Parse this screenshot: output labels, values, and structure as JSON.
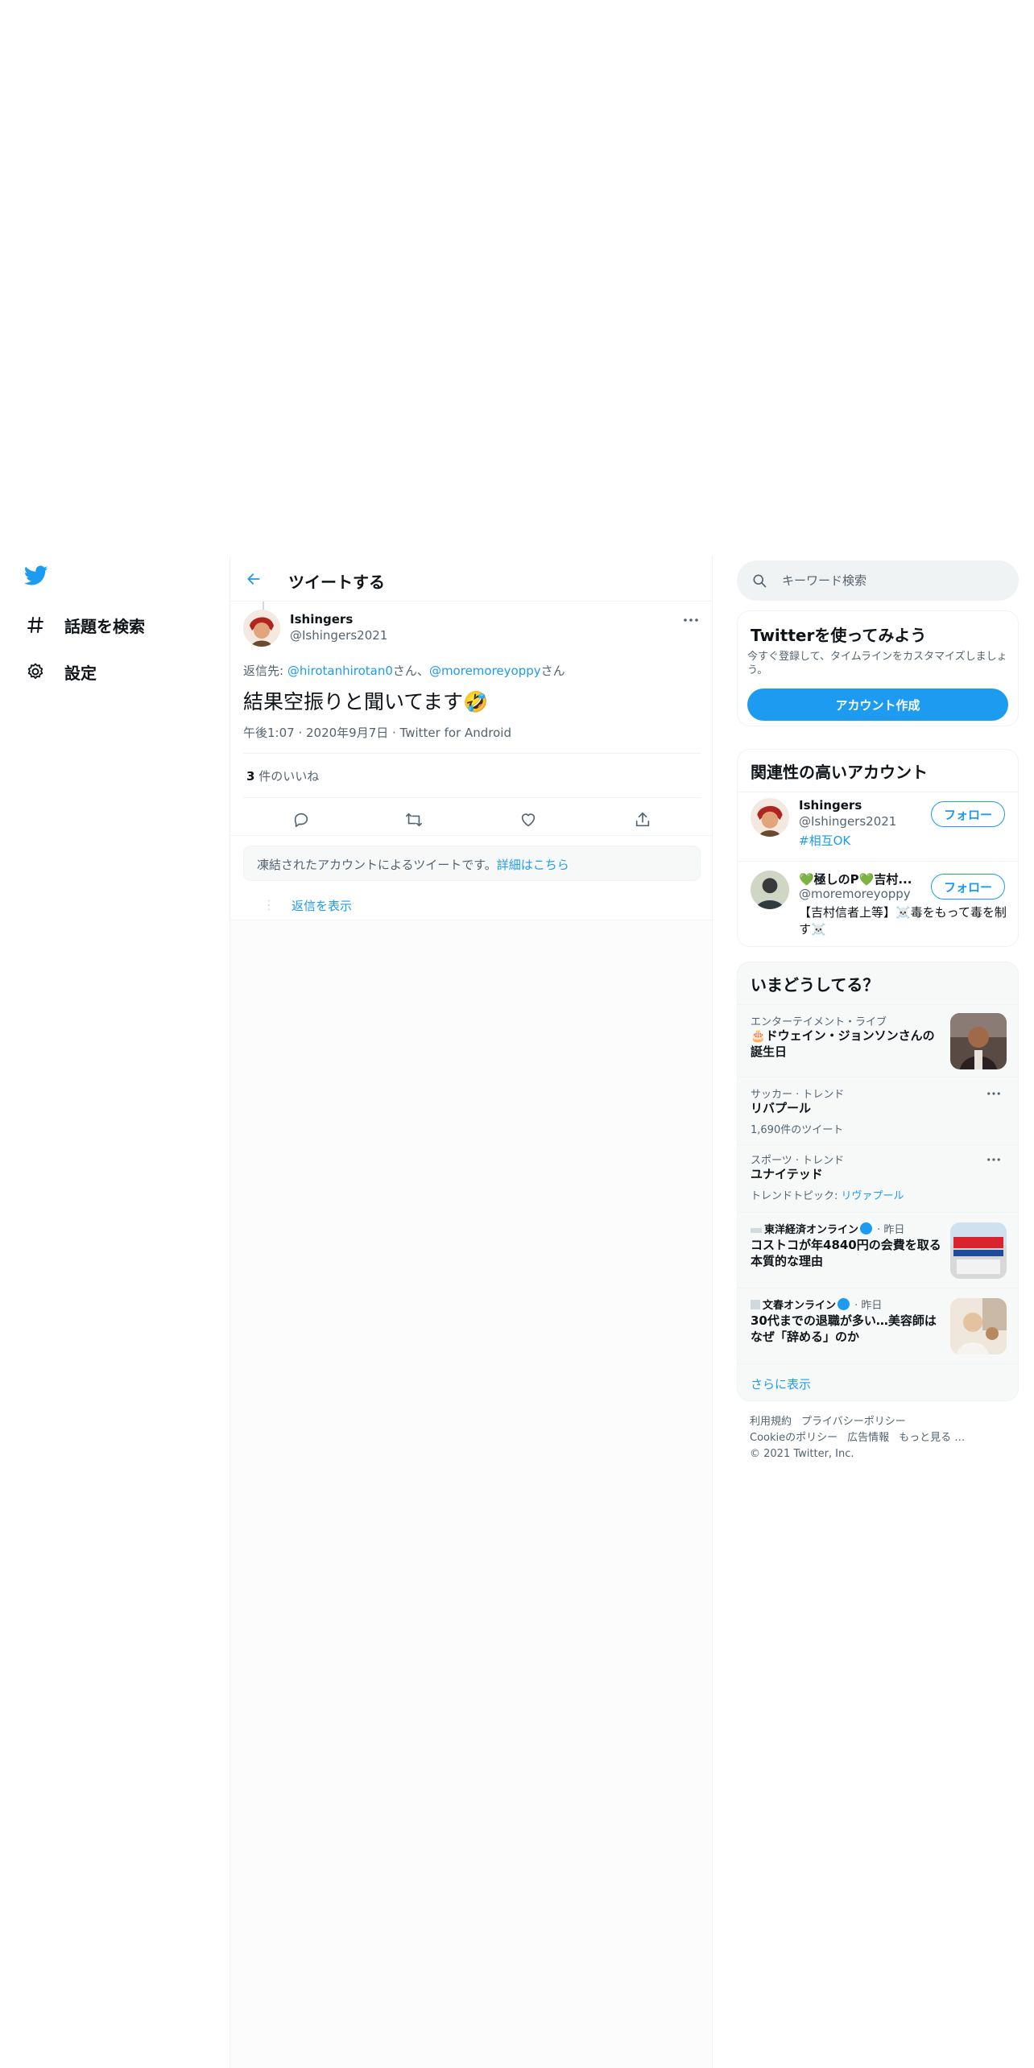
{
  "nav": {
    "logo": "twitter-bird-icon",
    "items": [
      {
        "label": "話題を検索",
        "icon": "hashtag-icon"
      },
      {
        "label": "設定",
        "icon": "gear-icon"
      }
    ]
  },
  "header": {
    "title": "ツイートする"
  },
  "tweet": {
    "name": "Ishingers",
    "handle": "@Ishingers2021",
    "reply_prefix": "返信先: ",
    "reply_user1": "@hirotanhirotan0",
    "reply_san1": "さん、",
    "reply_user2": "@moremoreyoppy",
    "reply_san2": "さん",
    "text": "結果空振りと聞いてます🤣",
    "meta": "午後1:07 · 2020年9月7日 · Twitter for Android",
    "likes_count": "3",
    "likes_label": " 件のいいね"
  },
  "notice": {
    "text": "凍結されたアカウントによるツイートです。",
    "link": "詳細はこちら"
  },
  "show_replies": "返信を表示",
  "search": {
    "placeholder": "キーワード検索"
  },
  "signup_card": {
    "title": "Twitterを使ってみよう",
    "subtitle": "今すぐ登録して、タイムラインをカスタマイズしましょう。",
    "button": "アカウント作成"
  },
  "accounts_card": {
    "title": "関連性の高いアカウント",
    "follow_label": "フォロー",
    "accounts": [
      {
        "name": "Ishingers",
        "handle": "@Ishingers2021",
        "bio": "#相互OK"
      },
      {
        "name": "💚極しのP💚吉村...",
        "handle": "@moremoreyoppy",
        "bio": "【吉村信者上等】☠️毒をもって毒を制す☠️"
      }
    ]
  },
  "trends_card": {
    "title": "いまどうしてる？",
    "trends": [
      {
        "category": "エンターテイメント・ライブ",
        "title": "🎂ドウェイン・ジョンソンさんの誕生日"
      },
      {
        "category": "サッカー · トレンド",
        "title": "リバプール",
        "count": "1,690件のツイート"
      },
      {
        "category": "スポーツ · トレンド",
        "title": "ユナイテッド",
        "count_prefix": "トレンドトピック: ",
        "count_link": "リヴァプール"
      },
      {
        "source": "東洋経済オンライン",
        "time": " · 昨日",
        "title": "コストコが年4840円の会費を取る本質的な理由"
      },
      {
        "source": "文春オンライン",
        "time": " · 昨日",
        "title": "30代までの退職が多い…美容師はなぜ「辞める」のか"
      }
    ],
    "show_more": "さらに表示"
  },
  "footer": {
    "links": [
      "利用規約",
      "プライバシーポリシー",
      "Cookieのポリシー",
      "広告情報",
      "もっと見る …"
    ],
    "copyright": "© 2021 Twitter, Inc."
  },
  "colors": {
    "accent": "#1d9bf0",
    "text": "#0f1419",
    "secondary": "#536471"
  }
}
